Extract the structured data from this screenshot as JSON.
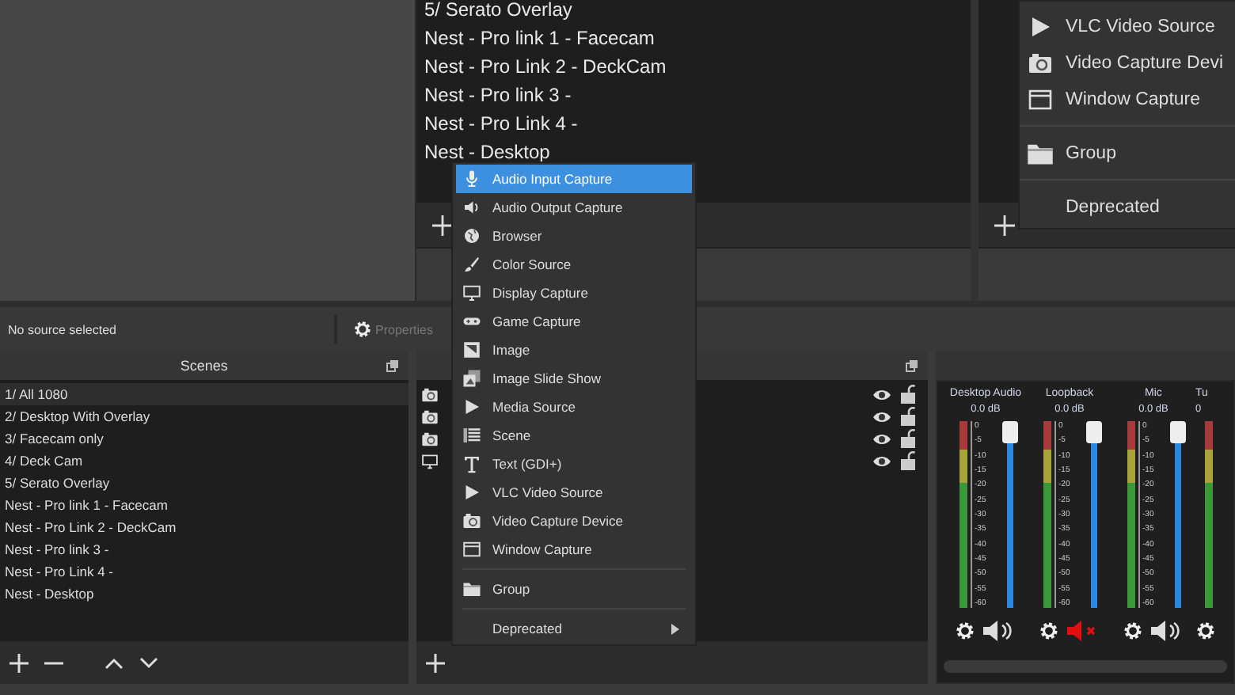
{
  "scenes_list_top": {
    "rows": [
      {
        "label": "5/ Serato Overlay"
      },
      {
        "label": "Nest - Pro link 1 - Facecam"
      },
      {
        "label": "Nest - Pro Link 2 - DeckCam"
      },
      {
        "label": "Nest - Pro link 3 -"
      },
      {
        "label": "Nest - Pro Link 4 -"
      },
      {
        "label": "Nest - Desktop"
      }
    ]
  },
  "add_menu_top": {
    "items": [
      {
        "kind": "source",
        "label": "VLC Video Source"
      },
      {
        "kind": "source",
        "label": "Video Capture Devi"
      },
      {
        "kind": "source",
        "label": "Window Capture"
      },
      {
        "kind": "group",
        "label": "Group"
      },
      {
        "kind": "submenu",
        "label": "Deprecated"
      }
    ]
  },
  "properties_bar": {
    "status": "No source selected",
    "button": {
      "label": "Properties",
      "disabled": true
    }
  },
  "scenes": {
    "title": "Scenes",
    "rows": [
      {
        "label": "1/ All 1080",
        "selected": true
      },
      {
        "label": "2/ Desktop With Overlay",
        "selected": false
      },
      {
        "label": "3/ Facecam only",
        "selected": false
      },
      {
        "label": "4/ Deck Cam",
        "selected": false
      },
      {
        "label": "5/ Serato Overlay",
        "selected": false
      },
      {
        "label": "Nest - Pro link 1 - Facecam",
        "selected": false
      },
      {
        "label": "Nest - Pro Link 2 - DeckCam",
        "selected": false
      },
      {
        "label": "Nest - Pro link 3 -",
        "selected": false
      },
      {
        "label": "Nest - Pro Link 4 -",
        "selected": false
      },
      {
        "label": "Nest - Desktop",
        "selected": false
      }
    ]
  },
  "sources": {
    "rows": [
      {
        "visible": true,
        "locked": false
      },
      {
        "visible": true,
        "locked": false
      },
      {
        "visible": true,
        "locked": false
      },
      {
        "visible": true,
        "locked": false
      }
    ]
  },
  "add_menu": {
    "items": [
      {
        "kind": "source",
        "label": "Audio Input Capture",
        "selected": true
      },
      {
        "kind": "source",
        "label": "Audio Output Capture",
        "selected": false
      },
      {
        "kind": "source",
        "label": "Browser",
        "selected": false
      },
      {
        "kind": "source",
        "label": "Color Source",
        "selected": false
      },
      {
        "kind": "source",
        "label": "Display Capture",
        "selected": false
      },
      {
        "kind": "source",
        "label": "Game Capture",
        "selected": false
      },
      {
        "kind": "source",
        "label": "Image",
        "selected": false
      },
      {
        "kind": "source",
        "label": "Image Slide Show",
        "selected": false
      },
      {
        "kind": "source",
        "label": "Media Source",
        "selected": false
      },
      {
        "kind": "source",
        "label": "Scene",
        "selected": false
      },
      {
        "kind": "source",
        "label": "Text (GDI+)",
        "selected": false
      },
      {
        "kind": "source",
        "label": "VLC Video Source",
        "selected": false
      },
      {
        "kind": "source",
        "label": "Video Capture Device",
        "selected": false
      },
      {
        "kind": "source",
        "label": "Window Capture",
        "selected": false
      },
      {
        "kind": "group",
        "label": "Group",
        "selected": false
      },
      {
        "kind": "submenu",
        "label": "Deprecated",
        "selected": false
      }
    ]
  },
  "mixer": {
    "channels": [
      {
        "kind": "full",
        "name": "Desktop Audio",
        "reading": "0.0 dB",
        "level": 1,
        "muted": false,
        "scale": [
          "0",
          "-5",
          "-10",
          "-15",
          "-20",
          "-25",
          "-30",
          "-35",
          "-40",
          "-45",
          "-50",
          "-55",
          "-60"
        ]
      },
      {
        "kind": "full",
        "name": "Loopback",
        "reading": "0.0 dB",
        "level": 1,
        "muted": true,
        "scale": [
          "0",
          "-5",
          "-10",
          "-15",
          "-20",
          "-25",
          "-30",
          "-35",
          "-40",
          "-45",
          "-50",
          "-55",
          "-60"
        ]
      },
      {
        "kind": "full",
        "name": "Mic",
        "reading": "0.0 dB",
        "level": 1,
        "muted": false,
        "scale": [
          "0",
          "-5",
          "-10",
          "-15",
          "-20",
          "-25",
          "-30",
          "-35",
          "-40",
          "-45",
          "-50",
          "-55",
          "-60"
        ]
      },
      {
        "kind": "edge",
        "name": "Tu",
        "reading": "0"
      }
    ]
  }
}
